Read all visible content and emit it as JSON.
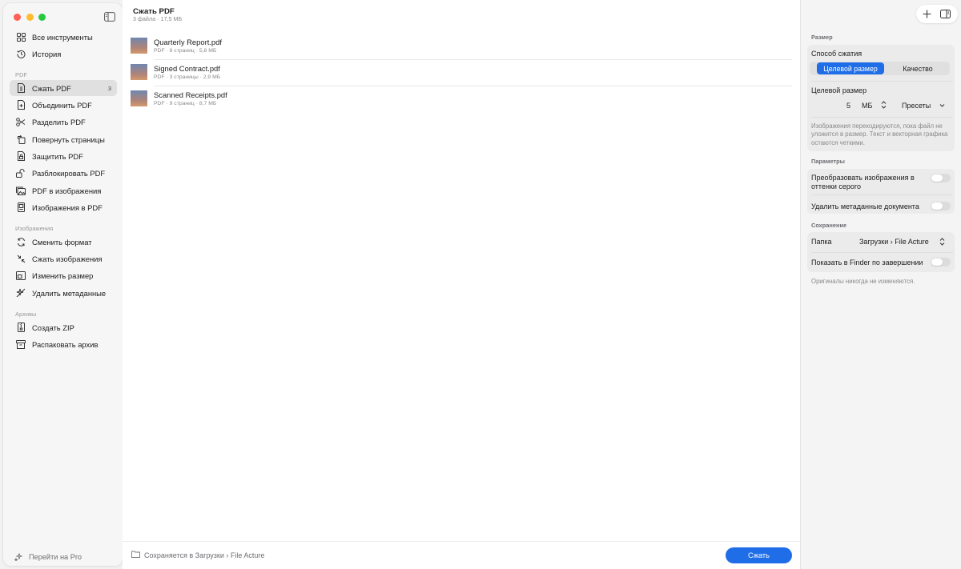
{
  "sidebar": {
    "items_top": [
      {
        "label": "Все инструменты",
        "icon": "grid-icon"
      },
      {
        "label": "История",
        "icon": "history-icon"
      }
    ],
    "sections": [
      {
        "title": "PDF",
        "items": [
          {
            "label": "Сжать PDF",
            "icon": "compress-pdf-icon",
            "badge": "3",
            "active": true
          },
          {
            "label": "Объединить PDF",
            "icon": "merge-pdf-icon"
          },
          {
            "label": "Разделить PDF",
            "icon": "scissors-icon"
          },
          {
            "label": "Повернуть страницы",
            "icon": "rotate-icon"
          },
          {
            "label": "Защитить PDF",
            "icon": "lock-doc-icon"
          },
          {
            "label": "Разблокировать PDF",
            "icon": "unlock-icon"
          },
          {
            "label": "PDF в изображения",
            "icon": "photo-stack-icon"
          },
          {
            "label": "Изображения в PDF",
            "icon": "image-doc-icon"
          }
        ]
      },
      {
        "title": "Изображения",
        "items": [
          {
            "label": "Сменить формат",
            "icon": "convert-icon"
          },
          {
            "label": "Сжать изображения",
            "icon": "shrink-icon"
          },
          {
            "label": "Изменить размер",
            "icon": "resize-icon"
          },
          {
            "label": "Удалить метаданные",
            "icon": "sparkle-remove-icon"
          }
        ]
      },
      {
        "title": "Архивы",
        "items": [
          {
            "label": "Создать ZIP",
            "icon": "zip-icon"
          },
          {
            "label": "Распаковать архив",
            "icon": "archive-icon"
          }
        ]
      }
    ],
    "pro_label": "Перейти на Pro"
  },
  "main": {
    "title": "Сжать PDF",
    "subtitle": "3 файла · 17,5 МБ",
    "files": [
      {
        "name": "Quarterly Report.pdf",
        "meta": "PDF · 6 страниц · 5,8 МБ"
      },
      {
        "name": "Signed Contract.pdf",
        "meta": "PDF · 3 страницы · 2,9 МБ"
      },
      {
        "name": "Scanned Receipts.pdf",
        "meta": "PDF · 9 страниц · 8,7 МБ"
      }
    ],
    "footer_text": "Сохраняется в Загрузки › File Acture",
    "compress_button": "Сжать"
  },
  "panel": {
    "size_section": "Размер",
    "method_label": "Способ сжатия",
    "method_options": [
      "Целевой размер",
      "Качество"
    ],
    "target_label": "Целевой размер",
    "target_value": "5",
    "target_unit": "МБ",
    "presets_label": "Пресеты",
    "size_note": "Изображения перекодируются, пока файл не уложится в размер. Текст и векторная графика остаются четкими.",
    "params_section": "Параметры",
    "grayscale_label": "Преобразовать изображения в оттенки серого",
    "grayscale_on": false,
    "strip_meta_label": "Удалить метаданные документа",
    "strip_meta_on": false,
    "save_section": "Сохранение",
    "folder_label": "Папка",
    "folder_value": "Загрузки › File Acture",
    "finder_label": "Показать в Finder по завершении",
    "finder_on": false,
    "originals_note": "Оригиналы никогда не изменяются."
  },
  "colors": {
    "accent": "#1f6ee8",
    "active_row": "#e0e0e0"
  }
}
